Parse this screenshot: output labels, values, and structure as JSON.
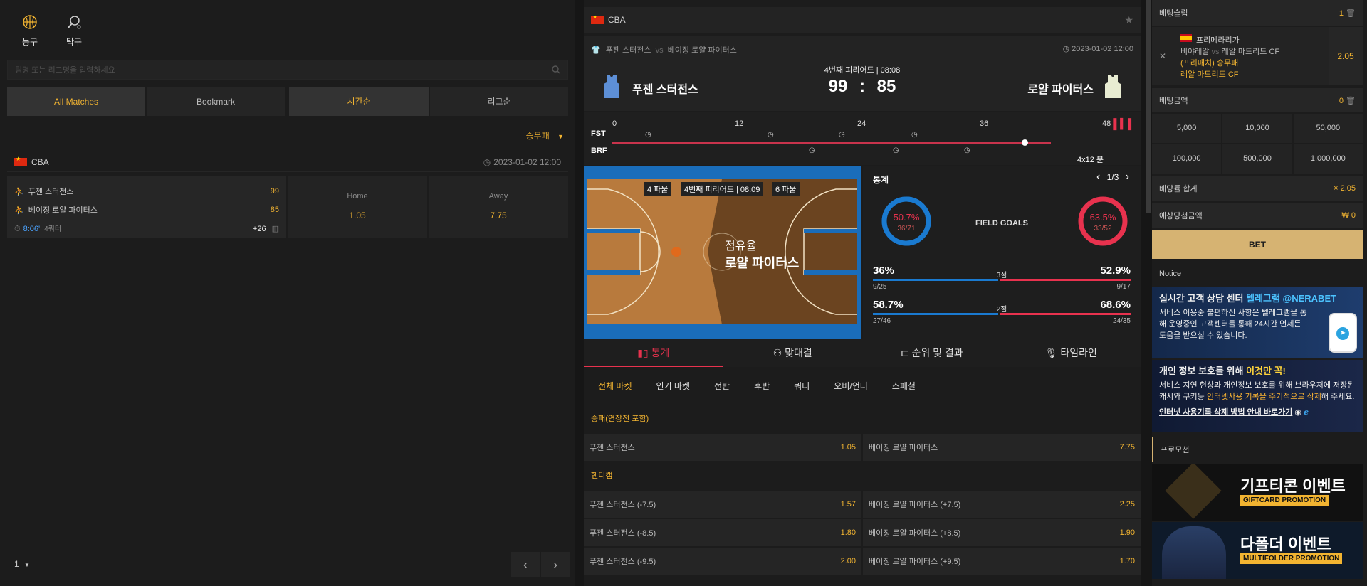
{
  "sports": [
    {
      "label": "농구",
      "icon": "basketball-icon"
    },
    {
      "label": "탁구",
      "icon": "table-tennis-icon"
    }
  ],
  "search": {
    "placeholder": "팀명 또는 리그명을 입력하세요"
  },
  "tabs": [
    "All Matches",
    "Bookmark",
    "시간순",
    "리그순"
  ],
  "filter": "승무패",
  "league": {
    "name": "CBA",
    "datetime": "2023-01-02 12:00"
  },
  "match": {
    "home": "푸젠 스터전스",
    "home_score": "99",
    "away": "베이징 로얄 파이터스",
    "away_score": "85",
    "time": "8:06'",
    "quarter": "4쿼터",
    "more": "+26",
    "home_label": "Home",
    "home_odd": "1.05",
    "away_label": "Away",
    "away_odd": "7.75"
  },
  "pager": {
    "page": "1"
  },
  "center": {
    "league": "CBA",
    "matchup_home": "푸젠 스터전스",
    "vs": "vs",
    "matchup_away": "베이징 로얄 파이터스",
    "datetime": "2023-01-02 12:00",
    "period": "4번째 피리어드 | 08:08",
    "home_team": "푸젠 스터전스",
    "away_team": "로얄 파이터스",
    "home_score": "99",
    "away_score": "85",
    "colon": ":",
    "timeline": {
      "ticks": [
        "0",
        "12",
        "24",
        "36",
        "48"
      ],
      "home": "FST",
      "away": "BRF",
      "format": "4x12 분"
    },
    "court": {
      "left_fouls": "4 파울",
      "period": "4번째 피리어드 | 08:09",
      "right_fouls": "6 파울",
      "possession_label": "점유율",
      "possession_team": "로얄 파이터스"
    },
    "stats": {
      "title": "통계",
      "page": "1/3",
      "home_pct": "50.7%",
      "home_frac": "36/71",
      "label": "FIELD GOALS",
      "away_pct": "63.5%",
      "away_frac": "33/52",
      "rows": [
        {
          "left_pct": "36%",
          "label": "3점",
          "right_pct": "52.9%",
          "left_frac": "9/25",
          "right_frac": "9/17"
        },
        {
          "left_pct": "58.7%",
          "label": "2점",
          "right_pct": "68.6%",
          "left_frac": "27/46",
          "right_frac": "24/35"
        }
      ]
    },
    "main_tabs": [
      "통계",
      "맞대결",
      "순위 및 결과",
      "타임라인"
    ],
    "sub_tabs": [
      "전체 마켓",
      "인기 마켓",
      "전반",
      "후반",
      "쿼터",
      "오버/언더",
      "스페셜"
    ],
    "section1": "승패(연장전 포함)",
    "ml": [
      {
        "l": "푸젠 스터전스",
        "lo": "1.05",
        "r": "베이징 로얄 파이터스",
        "ro": "7.75"
      }
    ],
    "section2": "핸디캡",
    "hc": [
      {
        "l": "푸젠 스터전스 (-7.5)",
        "lo": "1.57",
        "r": "베이징 로얄 파이터스 (+7.5)",
        "ro": "2.25"
      },
      {
        "l": "푸젠 스터전스 (-8.5)",
        "lo": "1.80",
        "r": "베이징 로얄 파이터스 (+8.5)",
        "ro": "1.90"
      },
      {
        "l": "푸젠 스터전스 (-9.5)",
        "lo": "2.00",
        "r": "베이징 로얄 파이터스 (+9.5)",
        "ro": "1.70"
      }
    ]
  },
  "slip": {
    "title": "베팅슬립",
    "count": "1",
    "league": "프리메라리가",
    "match_home": "비야레알",
    "vs": "vs",
    "match_away": "레알 마드리드 CF",
    "market": "(프리매치) 승무패",
    "pick": "레알 마드리드 CF",
    "odd": "2.05",
    "amount_label": "베팅금액",
    "amount": "0",
    "amounts": [
      "5,000",
      "10,000",
      "50,000",
      "100,000",
      "500,000",
      "1,000,000"
    ],
    "total_odds_label": "배당률 합계",
    "total_odds": "× 2.05",
    "expected_label": "예상당첨금액",
    "expected": "₩ 0",
    "bet": "BET"
  },
  "notice": {
    "title": "Notice",
    "b1_title": "실시간 고객 상담 센터 ",
    "b1_hl": "텔레그램 @NERABET",
    "b1_body": "서비스 이용중 불편하신 사항은 텔레그램을 통해 운영중인 고객센터를 통해 24시간 언제든 도움을 받으실 수 있습니다.",
    "b2_title": "개인 정보 보호를 위해 ",
    "b2_hl": "이것만 꼭!",
    "b2_body_a": "서비스 지연 현상과 개인정보 보호를 위해 브라우저에 저장된 캐시와 쿠키등 ",
    "b2_body_hl": "인터넷사용 기록을 주기적으로 삭제",
    "b2_body_b": "해 주세요.",
    "b2_link": "인터넷 사용기록 삭제 방법 안내 바로가기"
  },
  "promotion": {
    "title": "프로모션",
    "p1_title": "기프티콘 이벤트",
    "p1_sub": "GIFTCARD PROMOTION",
    "p2_title": "다폴더 이벤트",
    "p2_sub": "MULTIFOLDER PROMOTION"
  }
}
